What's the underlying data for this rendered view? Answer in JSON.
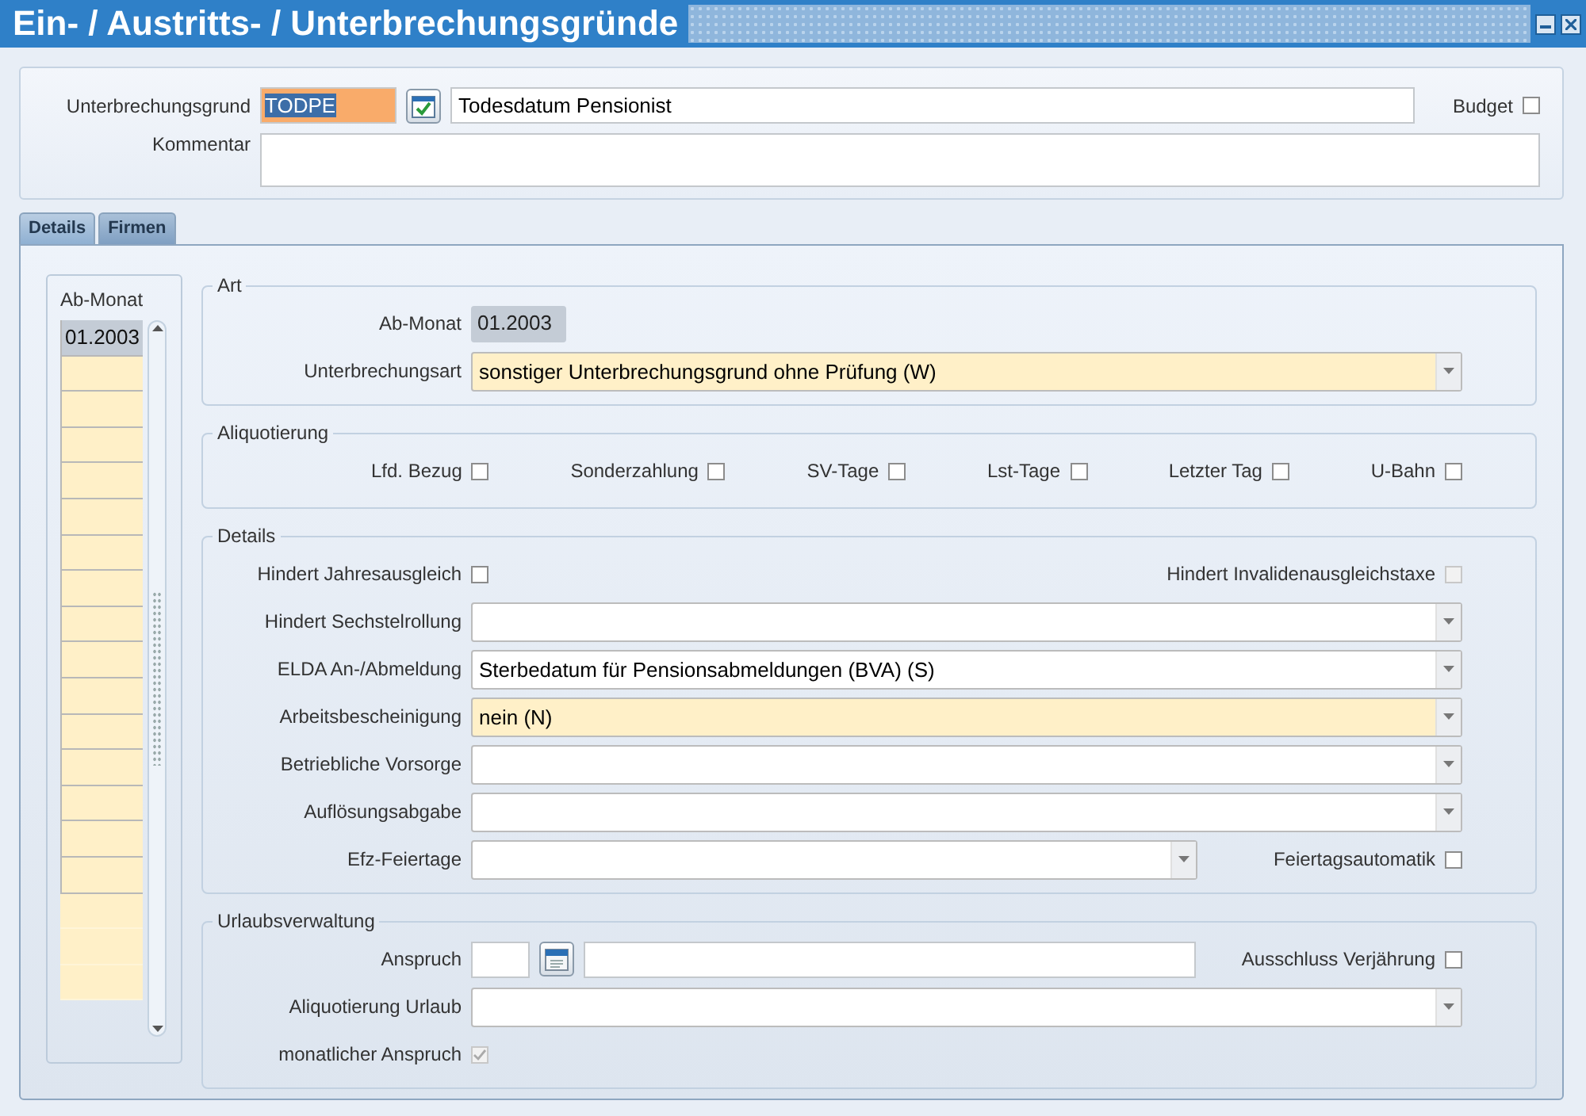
{
  "window": {
    "title": "Ein- / Austritts- / Unterbrechungsgründe"
  },
  "header": {
    "reason_label": "Unterbrechungsgrund",
    "reason_code": "TODPE",
    "reason_text": "Todesdatum Pensionist",
    "budget": {
      "label": "Budget",
      "checked": false
    },
    "comment_label": "Kommentar"
  },
  "tabs": [
    {
      "label": "Details",
      "selected": true
    },
    {
      "label": "Firmen",
      "selected": false
    }
  ],
  "month_list": {
    "header": "Ab-Monat",
    "items": [
      {
        "label": "01.2003",
        "selected": true
      }
    ]
  },
  "sections": [
    {
      "title": "Art",
      "rows": [
        {
          "kind": "display",
          "label": "Ab-Monat",
          "value": "01.2003"
        },
        {
          "kind": "select",
          "label": "Unterbrechungsart",
          "value": "sonstiger Unterbrechungsgrund ohne Prüfung (W)",
          "required": true
        }
      ]
    },
    {
      "title": "Aliquotierung",
      "rows": [
        {
          "kind": "checks",
          "items": [
            {
              "label": "Lfd. Bezug",
              "checked": false
            },
            {
              "label": "Sonderzahlung",
              "checked": false
            },
            {
              "label": "SV-Tage",
              "checked": false
            },
            {
              "label": "Lst-Tage",
              "checked": false
            },
            {
              "label": "Letzter Tag",
              "checked": false
            },
            {
              "label": "U-Bahn",
              "checked": false
            }
          ]
        }
      ]
    },
    {
      "title": "Details",
      "rows": [
        {
          "kind": "check-pair",
          "label": "Hindert Jahresausgleich",
          "checked": false,
          "side": {
            "label": "Hindert Invalidenausgleichstaxe",
            "checked": false,
            "disabled": true
          }
        },
        {
          "kind": "select",
          "label": "Hindert Sechstelrollung",
          "required": false
        },
        {
          "kind": "select",
          "label": "ELDA An-/Abmeldung",
          "value": "Sterbedatum für Pensionsabmeldungen (BVA) (S)",
          "required": false
        },
        {
          "kind": "select",
          "label": "Arbeitsbescheinigung",
          "value": "nein (N)",
          "required": true
        },
        {
          "kind": "select",
          "label": "Betriebliche Vorsorge",
          "required": false
        },
        {
          "kind": "select",
          "label": "Auflösungsabgabe",
          "required": false
        },
        {
          "kind": "select",
          "label": "Efz-Feiertage",
          "required": false,
          "side": {
            "label": "Feiertagsautomatik",
            "checked": false,
            "disabled": false
          }
        }
      ]
    },
    {
      "title": "Urlaubsverwaltung",
      "rows": [
        {
          "kind": "date",
          "label": "Anspruch",
          "side": {
            "label": "Ausschluss Verjährung",
            "checked": false,
            "disabled": false
          }
        },
        {
          "kind": "select",
          "label": "Aliquotierung Urlaub",
          "required": false
        },
        {
          "kind": "check",
          "label": "monatlicher Anspruch",
          "checked": true,
          "disabled": true
        }
      ]
    }
  ]
}
